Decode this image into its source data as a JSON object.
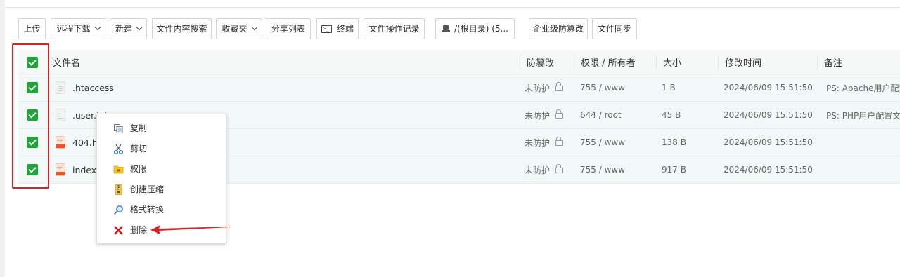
{
  "toolbar": {
    "upload": "上传",
    "remote_download": "远程下载",
    "new": "新建",
    "content_search": "文件内容搜索",
    "favorites": "收藏夹",
    "share_list": "分享列表",
    "terminal": "终端",
    "op_log": "文件操作记录",
    "disk": "/(根目录) (5...",
    "enterprise_tamper": "企业级防篡改",
    "file_sync": "文件同步"
  },
  "table": {
    "headers": {
      "name": "文件名",
      "tamper": "防篡改",
      "perm_owner": "权限 / 所有者",
      "size": "大小",
      "mtime": "修改时间",
      "remark": "备注"
    },
    "rows": [
      {
        "name": ".htaccess",
        "tamper": "未防护",
        "perm": "755 / www",
        "size": "1 B",
        "mtime": "2024/06/09 15:51:50",
        "remark": "PS: Apache用户配置",
        "icon": "file-icon"
      },
      {
        "name": ".user.ini",
        "tamper": "未防护",
        "perm": "644 / root",
        "size": "45 B",
        "mtime": "2024/06/09 15:51:50",
        "remark": "PS: PHP用户配置文",
        "icon": "file-icon"
      },
      {
        "name": "404.html",
        "tamper": "未防护",
        "perm": "755 / www",
        "size": "138 B",
        "mtime": "2024/06/09 15:51:50",
        "remark": "",
        "icon": "html-file-icon"
      },
      {
        "name": "index.html",
        "tamper": "未防护",
        "perm": "755 / www",
        "size": "917 B",
        "mtime": "2024/06/09 15:51:50",
        "remark": "",
        "icon": "html-file-icon"
      }
    ]
  },
  "context_menu": {
    "items": [
      {
        "label": "复制",
        "icon": "copy-icon"
      },
      {
        "label": "剪切",
        "icon": "scissors-icon"
      },
      {
        "label": "权限",
        "icon": "folder-lock-icon"
      },
      {
        "label": "创建压缩",
        "icon": "zip-icon"
      },
      {
        "label": "格式转换",
        "icon": "convert-icon"
      },
      {
        "label": "删除",
        "icon": "delete-x-icon"
      }
    ]
  },
  "colors": {
    "accent_green": "#20a53a",
    "highlight_red": "#e02020",
    "selected_row": "#f2f8f7"
  }
}
